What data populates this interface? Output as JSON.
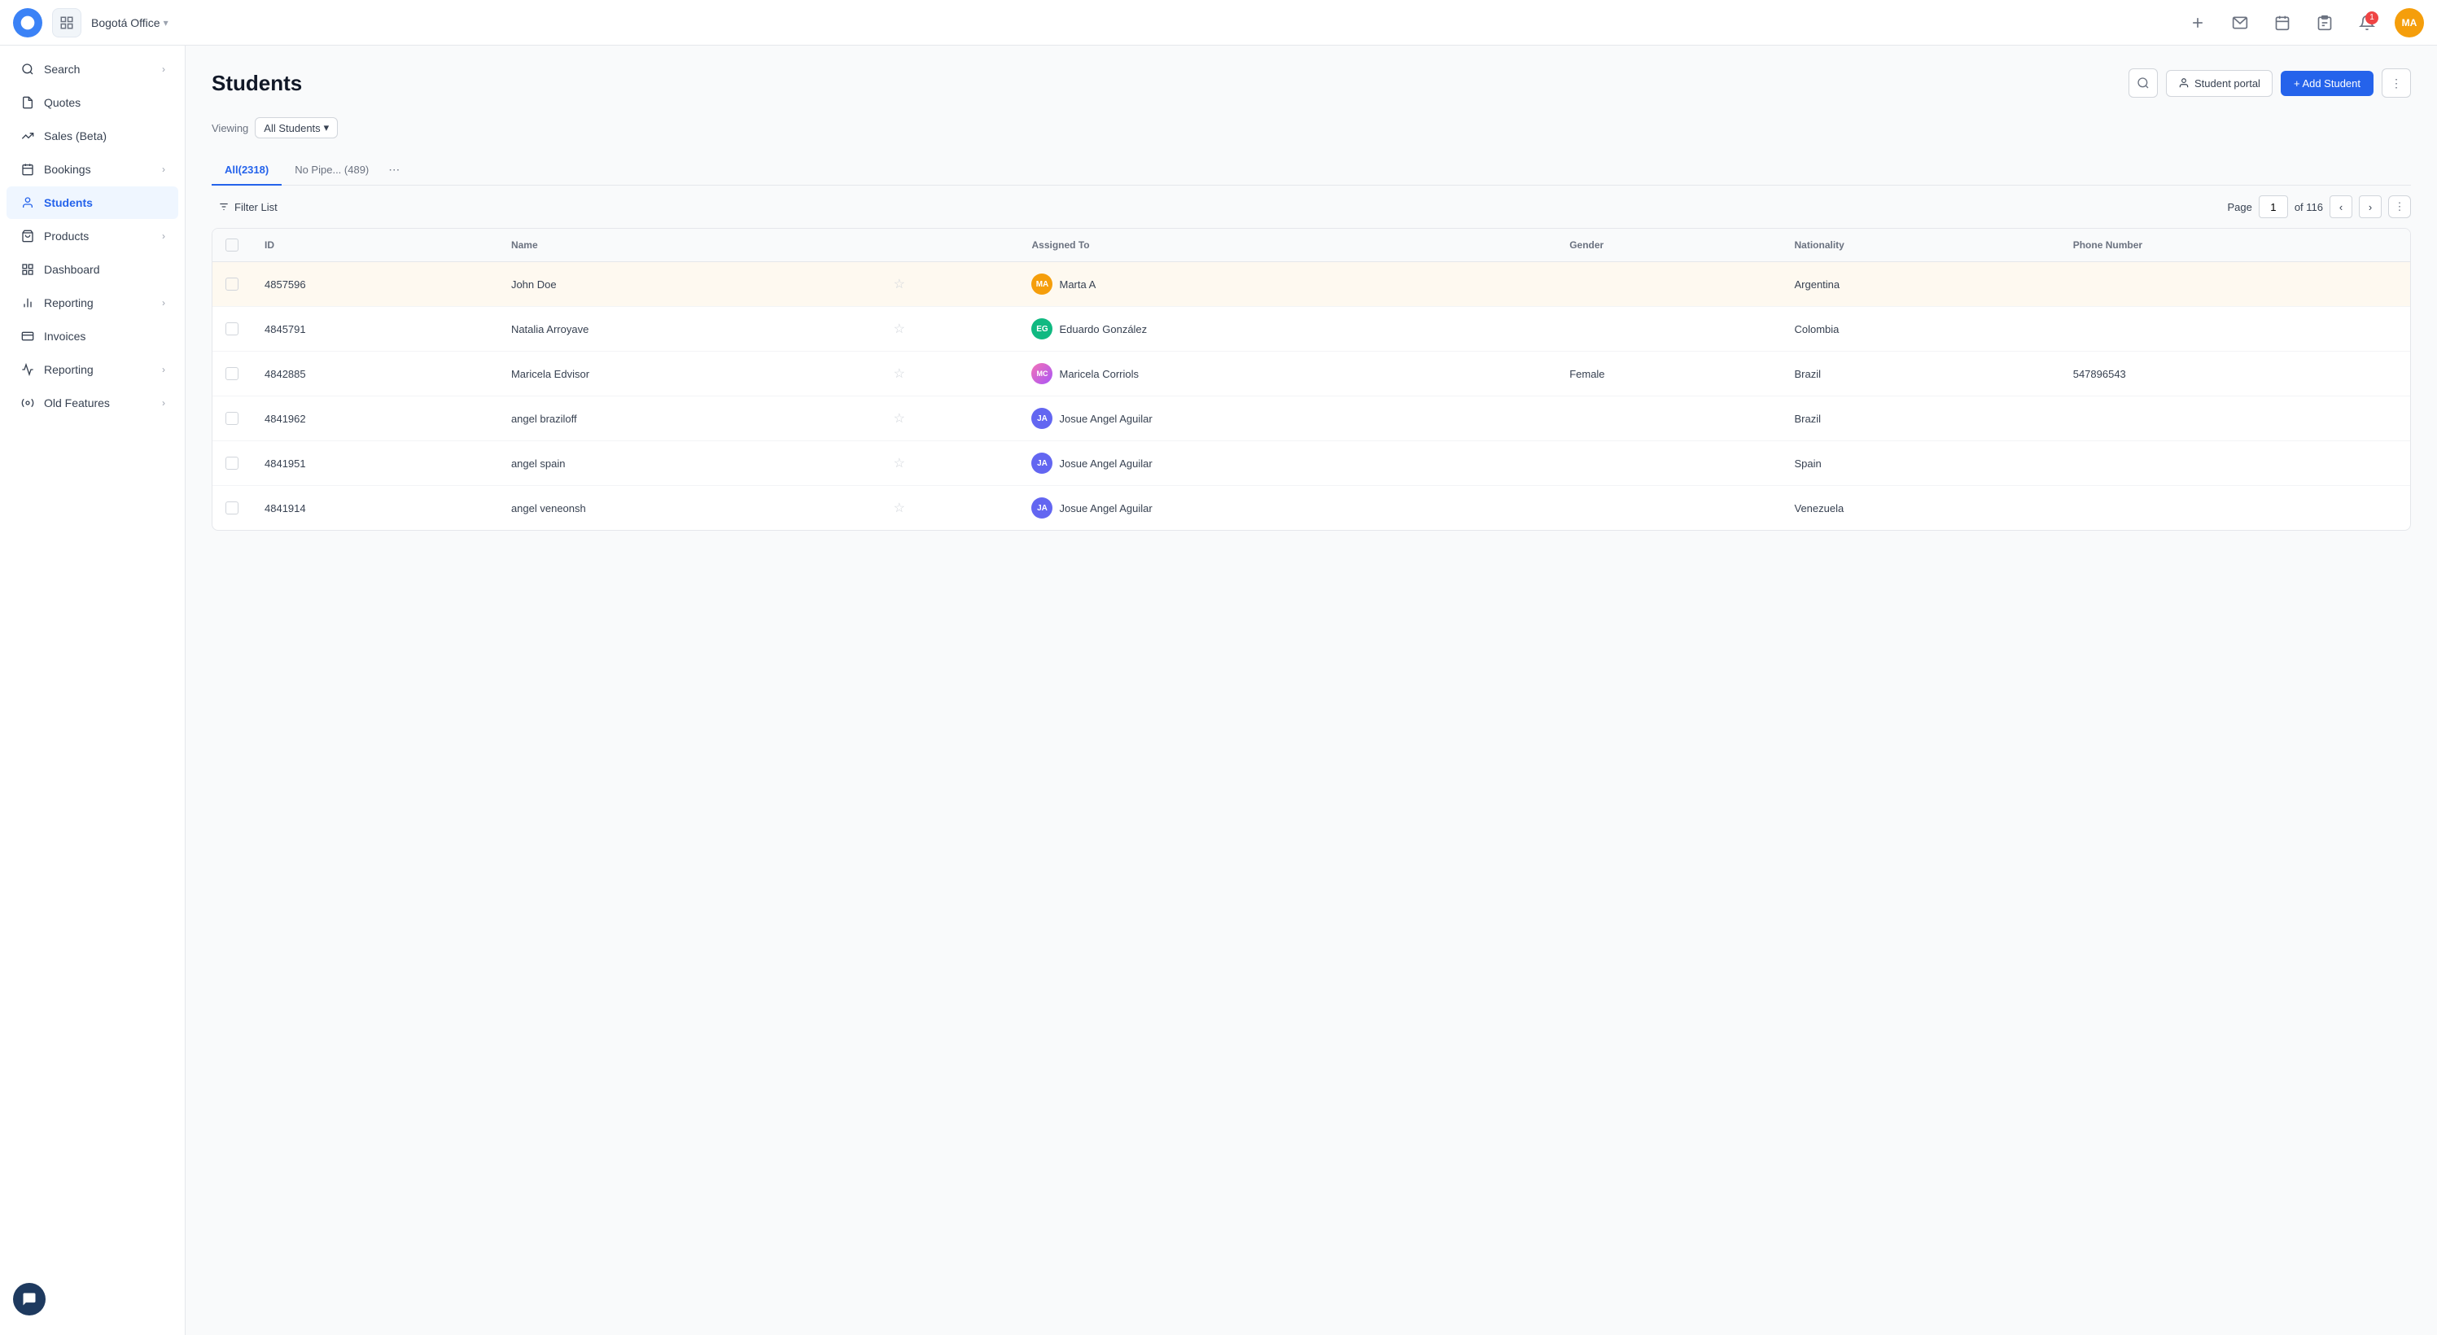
{
  "topbar": {
    "office_name": "Bogotá Office",
    "notification_count": "1",
    "avatar_initials": "MA"
  },
  "sidebar": {
    "items": [
      {
        "id": "search",
        "label": "Search",
        "icon": "search",
        "has_chevron": true,
        "active": false
      },
      {
        "id": "quotes",
        "label": "Quotes",
        "icon": "quotes",
        "has_chevron": false,
        "active": false
      },
      {
        "id": "sales-beta",
        "label": "Sales (Beta)",
        "icon": "sales",
        "has_chevron": false,
        "active": false
      },
      {
        "id": "bookings",
        "label": "Bookings",
        "icon": "bookings",
        "has_chevron": true,
        "active": false
      },
      {
        "id": "students",
        "label": "Students",
        "icon": "students",
        "has_chevron": false,
        "active": true
      },
      {
        "id": "products",
        "label": "Products",
        "icon": "products",
        "has_chevron": true,
        "active": false
      },
      {
        "id": "dashboard",
        "label": "Dashboard",
        "icon": "dashboard",
        "has_chevron": false,
        "active": false
      },
      {
        "id": "reporting",
        "label": "Reporting",
        "icon": "reporting",
        "has_chevron": true,
        "active": false
      },
      {
        "id": "invoices",
        "label": "Invoices",
        "icon": "invoices",
        "has_chevron": false,
        "active": false
      },
      {
        "id": "reporting2",
        "label": "Reporting",
        "icon": "reporting2",
        "has_chevron": true,
        "active": false
      },
      {
        "id": "old-features",
        "label": "Old Features",
        "icon": "old-features",
        "has_chevron": true,
        "active": false
      }
    ]
  },
  "page": {
    "title": "Students",
    "viewing_label": "Viewing",
    "viewing_value": "All Students",
    "search_btn_label": "",
    "student_portal_label": "Student portal",
    "add_student_label": "+ Add Student",
    "more_label": "⋮"
  },
  "tabs": [
    {
      "label": "All(2318)",
      "active": true
    },
    {
      "label": "No Pipe... (489)",
      "active": false
    }
  ],
  "table": {
    "filter_label": "Filter List",
    "page_label": "Page",
    "page_current": "1",
    "page_total": "of 116",
    "columns": [
      "ID",
      "Name",
      "",
      "Assigned To",
      "Gender",
      "Nationality",
      "Phone Number"
    ],
    "rows": [
      {
        "id": "4857596",
        "name": "John Doe",
        "assigned_to": "Marta A",
        "assigned_avatar": "MA",
        "assigned_color": "amber",
        "gender": "",
        "nationality": "Argentina",
        "phone": "",
        "highlighted": true
      },
      {
        "id": "4845791",
        "name": "Natalia Arroyave",
        "assigned_to": "Eduardo González",
        "assigned_avatar": "EG",
        "assigned_color": "green",
        "gender": "",
        "nationality": "Colombia",
        "phone": "",
        "highlighted": false
      },
      {
        "id": "4842885",
        "name": "Maricela Edvisor",
        "assigned_to": "Maricela Corriols",
        "assigned_avatar": "MC",
        "assigned_color": "pink",
        "gender": "Female",
        "nationality": "Brazil",
        "phone": "547896543",
        "highlighted": false
      },
      {
        "id": "4841962",
        "name": "angel braziloff",
        "assigned_to": "Josue Angel Aguilar",
        "assigned_avatar": "JA",
        "assigned_color": "indigo",
        "gender": "",
        "nationality": "Brazil",
        "phone": "",
        "highlighted": false
      },
      {
        "id": "4841951",
        "name": "angel spain",
        "assigned_to": "Josue Angel Aguilar",
        "assigned_avatar": "JA",
        "assigned_color": "indigo",
        "gender": "",
        "nationality": "Spain",
        "phone": "",
        "highlighted": false
      },
      {
        "id": "4841914",
        "name": "angel veneonsh",
        "assigned_to": "Josue Angel Aguilar",
        "assigned_avatar": "JA",
        "assigned_color": "indigo",
        "gender": "",
        "nationality": "Venezuela",
        "phone": "",
        "highlighted": false
      }
    ]
  }
}
